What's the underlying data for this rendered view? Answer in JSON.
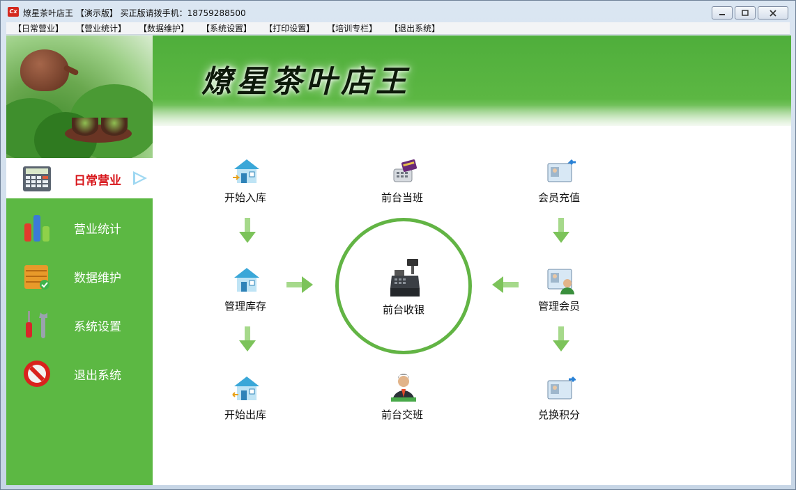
{
  "window": {
    "title": "燎星茶叶店王 【演示版】 买正版请拨手机：18759288500",
    "app_icon_text": "Cx",
    "controls": {
      "minimize": "minimize-icon",
      "maximize": "maximize-icon",
      "close": "close-icon"
    }
  },
  "menu": [
    "【日常营业】",
    "【营业统计】",
    "【数据维护】",
    "【系统设置】",
    "【打印设置】",
    "【培训专栏】",
    "【退出系统】"
  ],
  "banner": {
    "title": "燎星茶叶店王"
  },
  "sidebar": {
    "items": [
      {
        "label": "日常营业",
        "icon": "calculator-icon",
        "active": true
      },
      {
        "label": "营业统计",
        "icon": "bar-chart-icon",
        "active": false
      },
      {
        "label": "数据维护",
        "icon": "crate-icon",
        "active": false
      },
      {
        "label": "系统设置",
        "icon": "tools-icon",
        "active": false
      },
      {
        "label": "退出系统",
        "icon": "no-entry-icon",
        "active": false
      }
    ]
  },
  "panel": {
    "start_stock_in": {
      "label": "开始入库",
      "icon": "house-in-icon"
    },
    "manage_stock": {
      "label": "管理库存",
      "icon": "house-icon"
    },
    "start_stock_out": {
      "label": "开始出库",
      "icon": "house-out-icon"
    },
    "front_on_duty": {
      "label": "前台当班",
      "icon": "card-reader-icon"
    },
    "front_cashier": {
      "label": "前台收银",
      "icon": "cash-register-icon"
    },
    "front_handover": {
      "label": "前台交班",
      "icon": "cashier-person-icon"
    },
    "member_recharge": {
      "label": "会员充值",
      "icon": "member-card-in-icon"
    },
    "manage_members": {
      "label": "管理会员",
      "icon": "member-card-icon"
    },
    "redeem_points": {
      "label": "兑换积分",
      "icon": "member-card-out-icon"
    }
  },
  "colors": {
    "sidebar_green": "#5cb843",
    "banner_green": "#4fae3b",
    "active_label": "#d8161b",
    "ring": "#62b444"
  }
}
